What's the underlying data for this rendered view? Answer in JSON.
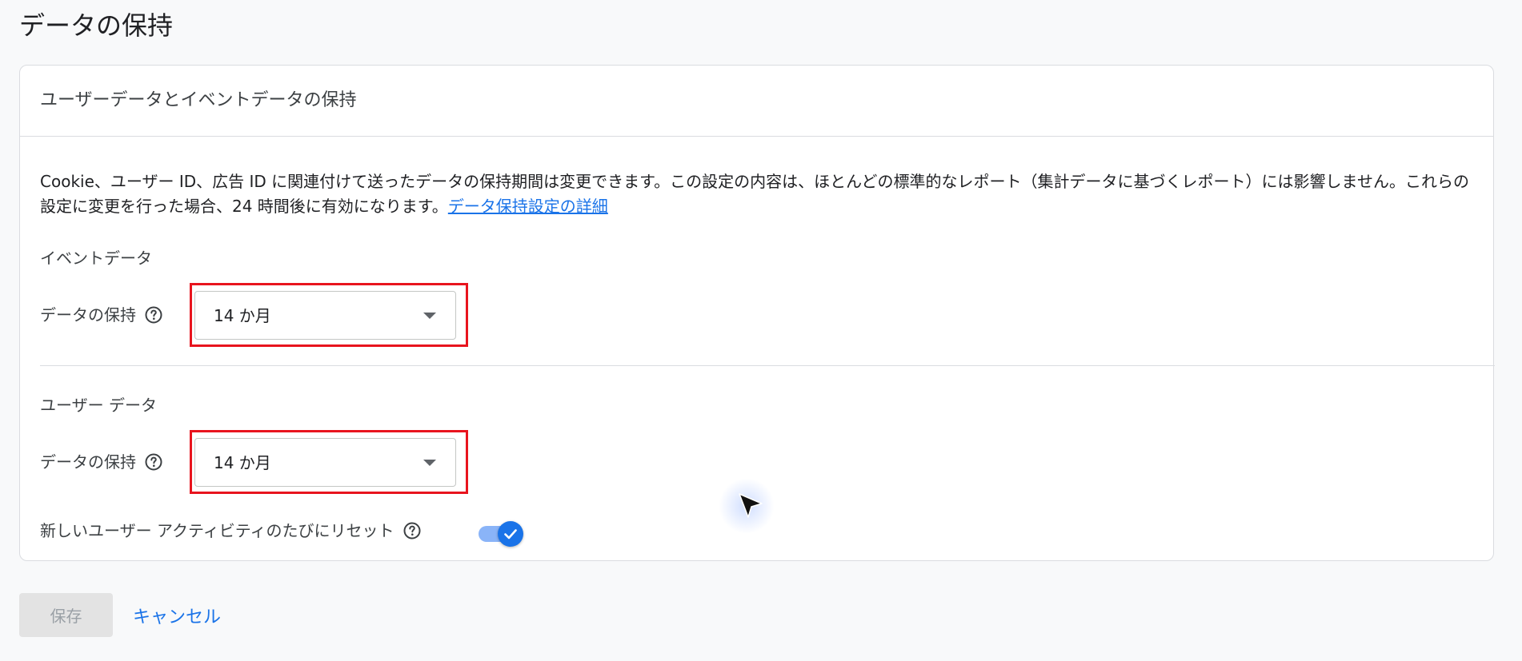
{
  "page": {
    "title": "データの保持"
  },
  "card": {
    "title": "ユーザーデータとイベントデータの保持",
    "description_text": "Cookie、ユーザー ID、広告 ID に関連付けて送ったデータの保持期間は変更できます。この設定の内容は、ほとんどの標準的なレポート（集計データに基づくレポート）には影響しません。これらの設定に変更を行った場合、24 時間後に有効になります。",
    "description_link": "データ保持設定の詳細"
  },
  "event_data": {
    "section_label": "イベントデータ",
    "field_label": "データの保持",
    "selected_value": "14 か月"
  },
  "user_data": {
    "section_label": "ユーザー データ",
    "field_label": "データの保持",
    "selected_value": "14 か月",
    "reset_label": "新しいユーザー アクティビティのたびにリセット",
    "reset_enabled": true
  },
  "actions": {
    "save_label": "保存",
    "cancel_label": "キャンセル"
  },
  "colors": {
    "accent": "#1a73e8",
    "highlight": "#e8141e",
    "toggle_track": "#8ab4f8",
    "disabled_button": "#e3e3e3"
  },
  "icons": [
    "help-circle-icon",
    "dropdown-arrow-icon",
    "check-icon",
    "mouse-cursor-icon"
  ]
}
